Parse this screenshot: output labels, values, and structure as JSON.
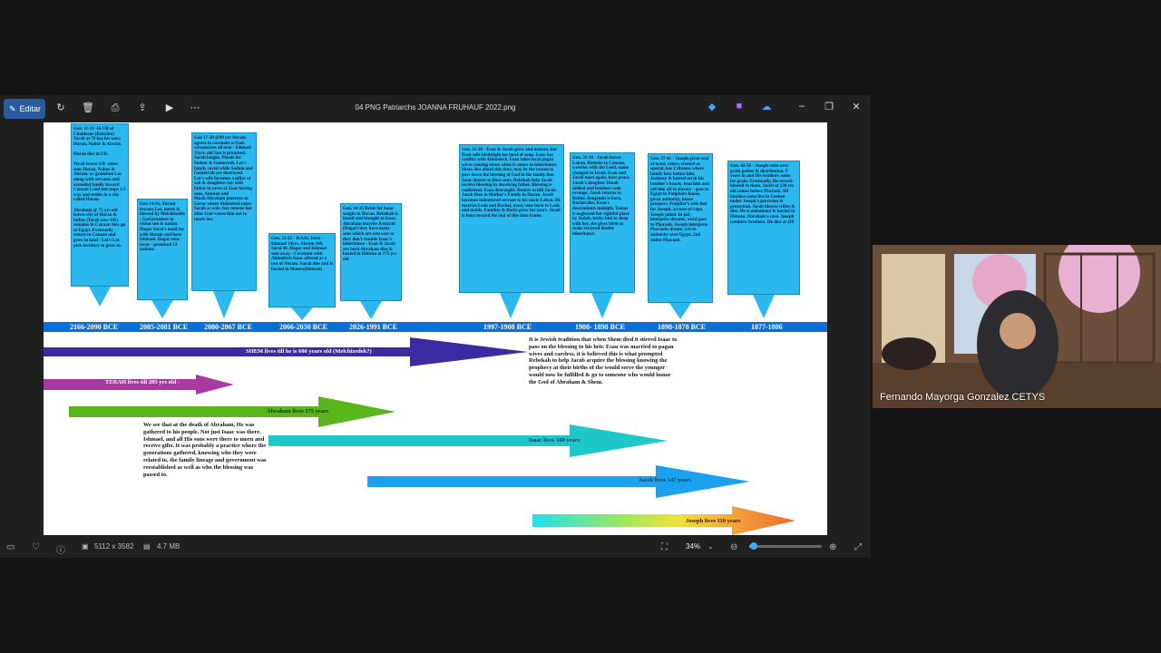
{
  "toolbar": {
    "edit_label": "Editar",
    "title": "04 PNG Patriarchs JOANNA FRUHAUF 2022.png"
  },
  "boxes": [
    {
      "text": "Gen. 11-13 -In UR of Chaldeans (Babylon) Terah at 70 has his sons; Haran, Nahor & Abram.\n\nHaran dies in UR.\n\nTerah leaves UR- takes sons Haran, Nahor & Abram, w/ grandson Lot along with servants and extended family toward Canaan Land but stops 1/2 way and settles in a city called Haran.\n\nAbraham @ 75 yrs old leaves city of Haran & father (Terah  now 145) remains in Canaan they go to Egypt. Eventually return to Canaan and grow in land - Lot's Lot pick territory to grow in."
    },
    {
      "text": "Gen 14-16, Abram rescues Lot, meets  & blessed by Melchizedek . God promises in vision son & nation. Hagar Sarai's maid lay with Abram and have Ishmael. Hagar runs away - promised 12 nations."
    },
    {
      "text": "Gen 17-20 @99 yrs Abram agrees to covenant w/God, circumcises all men - Ishmael 13yrs. old Son is promised. Sarah laughs. Pleads for Sodom & Gomorrah. Lot's family saved while Sodom and Gomorrah are destroyed. Lot's wife becomes a pillar of salt & daughters lay with father in caves of Zoar having sons, Ammon and Moab.Abraham journeys to Gerar where Abimelech takes Sarah as wife, but returns her after God warns him not to touch her."
    },
    {
      "text": "Gen. 21-23 - ISAAC born - Ishmael 14yrs. Abram 100, Sarai 90. Hagar and Ishmael sent away - Covenant with Abimelech Isaac offered as a test of Abram. Sarah dies and is buried in Mamre(Hebron)"
    },
    {
      "text": "Gen. 24-25 Bride for Isaac sought in Haran. Rebekah is found and brought to Isaac. Abraham marries Keturah (Hagar) they have many sons which are sent east so they don't trouble Isaac's inheritance - Esau & Jacob are born Abraham dies & buried in Hebron at 175 yrs old"
    },
    {
      "text": "Gen. 25-30 - Esau & Jacob grow and mature, but Esau sells birthright for bowl of soup. Isaac has conflict with Abimelech. Esau takes local pagan wives causing stress when it comes to inheritance. Shem dies about this time, may be the reason to pass down the blessing of God in the family line. Isaac desires to bless sons. Rebekah help Jacob receive blessing by deceiving father. Blessing is confirmed. Esau distraught. Desires to kill Jacob.  Jacob flees to Mother's Family in Haran. Jacob becomes indentured servant to his uncle Laban. He marries  Leah and Rachel, many sons born to Leah and maids. Families & flocks grow for years. Jacob is born toward the end of this time frame."
    },
    {
      "text": "Gen. 31-38 - Jacob leaves Laban, Returns to Canaan, wrestles with the Lord, name changed to Israel. Esau and Jacob meet again, have peace. Jacob's daughter Dinah defiled and brothers seek revenge. Jacob returns to Bethel. Benjamin is born, Rachel dies. Esau's descendants multiply.  Tamar is neglected her rightful place by Judah,  tricks him to sleep with her, she gives birth to twins recieved double inheritance."
    },
    {
      "text": "Gen. 37-41 - Joseph given coat of many colors, treated as special, has 2 dreams where family bow before him.  Jealousy & hatred set in his brother's hearts, beat him and sell him off to slavery - goes to Egypt in Potiphars house, given authority, house prospers. Potiphar's wife lust for Joseph, accuses of rape, Joseph jailed.  In jail, interprets dreams, word goes to Pharaoh.  Joseph interprets Pharaohs dream.  Given authority over Egypt, 2nd under Pharaoh."
    },
    {
      "text": "Gen. 42-50 - Joseph rules over grain gather & distribution. 9 years in and His brothers come for grain. Eventually, He reveals himself to them.  Jacob at 130 yrs old comes before Pharaoh. All families come live in Goshen under Joseph's provision & protection. Jacob blesses tribes & dies. He is embalmed & buried in Hebron, Abraham's cave. Joseph comforts brothers. He dies at 110"
    }
  ],
  "dates": [
    "2166-2090 BCE",
    "2085-2081 BCE",
    "2080-2067 BCE",
    "2066-2030 BCE",
    "2026-1991 BCE",
    "1997-1908 BCE",
    "1908- 1898 BCE",
    "1898-1878 BCE",
    "1877-1806"
  ],
  "arrows": {
    "shem": "SHEM lives till he is 600 years old  (Melchizedek?)",
    "terah": "TERAH lives till 205 yrs old -",
    "abraham": "Abraham lives 175 years",
    "isaac": "Isaac lives 180 years",
    "jacob": "Jacob lives 147 years",
    "joseph": "Joseph lives 110 years"
  },
  "notes": {
    "shem_note": "It is Jewish tradition that when Shem died it stirred Isaac to pass on the blessing to his heir. Esau was married to pagan wives and careless, it is believed this is what prompted Rebekah to help Jacob acquire the blessing knowing the prophecy at their births of the would serve the younger would now be fulfilled & go to someone who would honor the God of Abraham & Shem.",
    "abraham_note": "We see that at the death of Abraham, He was gathered to his people. Not just Isaac was there, Ishmael, and all His sons were there to morn and receive gifts.  It was probably a practice where the generations gathered, knowing who they were related to, the family lineage and government was reestablished as well as who the blessing was passed to."
  },
  "status": {
    "dimensions": "5112 x 3582",
    "size": "4.7 MB",
    "zoom": "34%"
  },
  "webcam": {
    "name": "Fernando Mayorga Gonzalez CETYS"
  }
}
